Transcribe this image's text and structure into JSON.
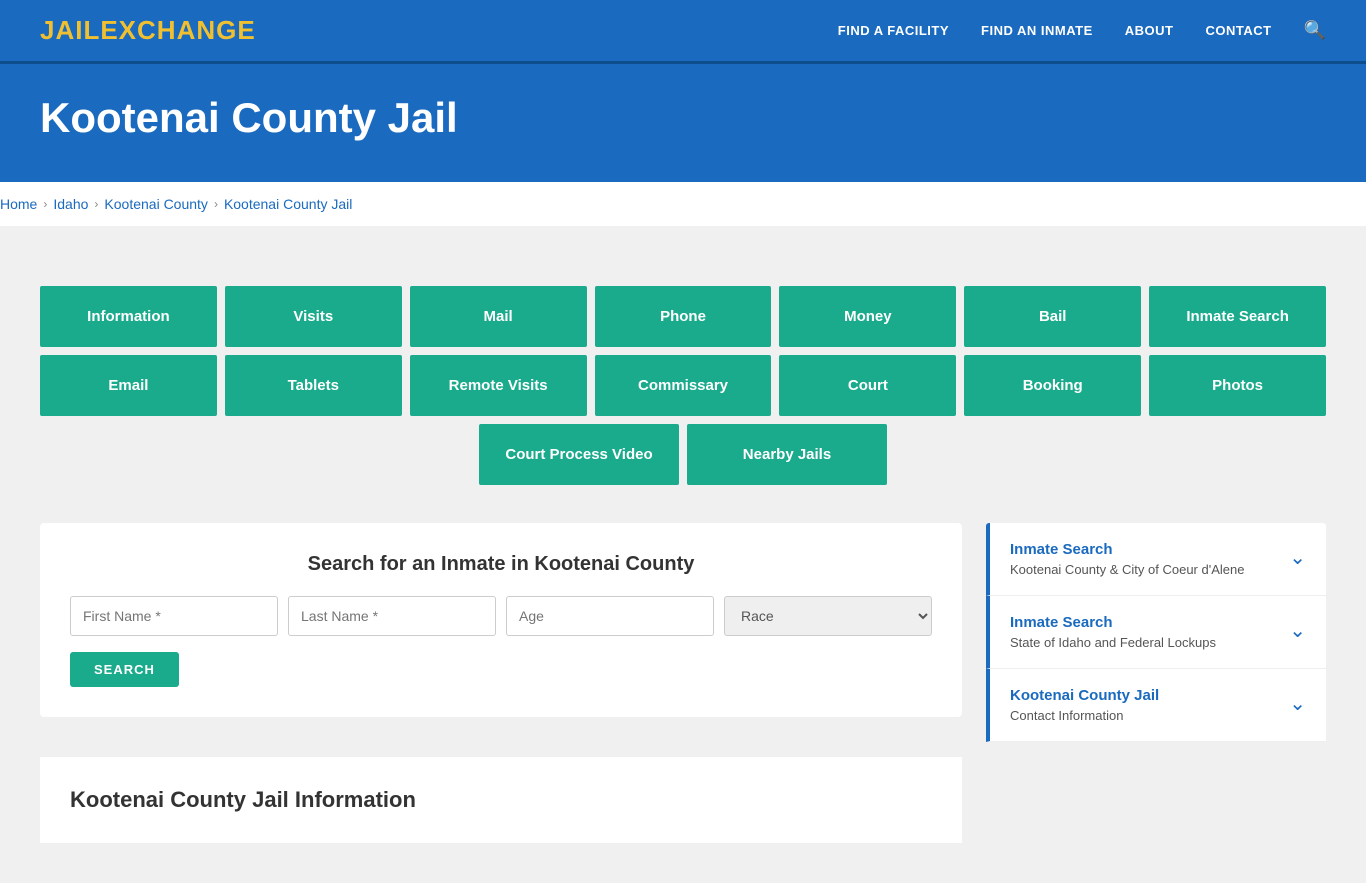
{
  "header": {
    "logo_jail": "JAIL",
    "logo_exchange": "EXCHANGE",
    "nav": [
      {
        "label": "FIND A FACILITY",
        "id": "find-facility"
      },
      {
        "label": "FIND AN INMATE",
        "id": "find-inmate"
      },
      {
        "label": "ABOUT",
        "id": "about"
      },
      {
        "label": "CONTACT",
        "id": "contact"
      }
    ]
  },
  "hero": {
    "title": "Kootenai County Jail"
  },
  "breadcrumb": {
    "items": [
      "Home",
      "Idaho",
      "Kootenai County",
      "Kootenai County Jail"
    ]
  },
  "tiles_row1": [
    {
      "label": "Information"
    },
    {
      "label": "Visits"
    },
    {
      "label": "Mail"
    },
    {
      "label": "Phone"
    },
    {
      "label": "Money"
    },
    {
      "label": "Bail"
    },
    {
      "label": "Inmate Search"
    }
  ],
  "tiles_row2": [
    {
      "label": "Email"
    },
    {
      "label": "Tablets"
    },
    {
      "label": "Remote Visits"
    },
    {
      "label": "Commissary"
    },
    {
      "label": "Court"
    },
    {
      "label": "Booking"
    },
    {
      "label": "Photos"
    }
  ],
  "tiles_row3": [
    {
      "label": "Court Process Video"
    },
    {
      "label": "Nearby Jails"
    }
  ],
  "search": {
    "title": "Search for an Inmate in Kootenai County",
    "first_name_placeholder": "First Name *",
    "last_name_placeholder": "Last Name *",
    "age_placeholder": "Age",
    "race_placeholder": "Race",
    "button_label": "SEARCH"
  },
  "sidebar": {
    "cards": [
      {
        "title": "Inmate Search",
        "subtitle": "Kootenai County & City of Coeur d'Alene"
      },
      {
        "title": "Inmate Search",
        "subtitle": "State of Idaho and Federal Lockups"
      },
      {
        "title": "Kootenai County Jail",
        "subtitle": "Contact Information"
      }
    ]
  },
  "info_section": {
    "title": "Kootenai County Jail Information"
  }
}
